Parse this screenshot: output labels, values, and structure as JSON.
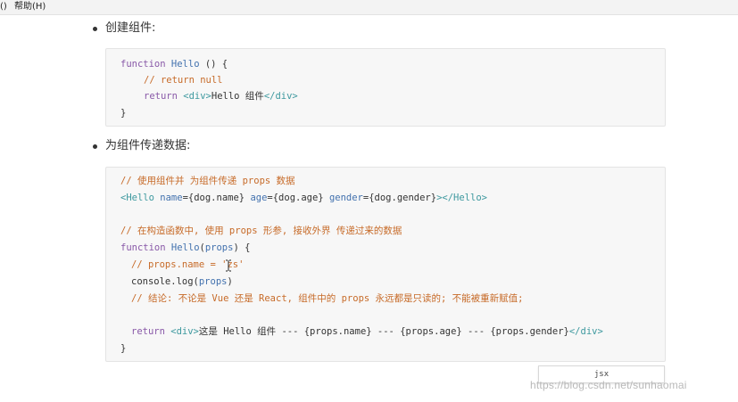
{
  "menubar": {
    "fragment": "()",
    "help": "帮助(H)"
  },
  "sections": [
    {
      "bullet_text": "创建组件:"
    },
    {
      "bullet_text": "为组件传递数据:"
    }
  ],
  "code1": {
    "l1": {
      "kw": "function",
      "fn": "Hello",
      "rest": " () {"
    },
    "l2": {
      "cm": "// return null"
    },
    "l3": {
      "kw": "return",
      "tag_open": "<div>",
      "text": "Hello 组件",
      "tag_close": "</div>"
    },
    "l4": {
      "text": "}"
    }
  },
  "code2": {
    "l1": {
      "cm": "// 使用组件并 为组件传递 props 数据"
    },
    "l2": {
      "tag_start": "<Hello",
      "a1": "name",
      "v1": "={dog.name}",
      "a2": "age",
      "v2": "={dog.age}",
      "a3": "gender",
      "v3": "={dog.gender}",
      "tag_end": "></Hello>"
    },
    "l3": {
      "cm": "// 在构造函数中, 使用 props 形参, 接收外界 传递过来的数据"
    },
    "l4": {
      "kw": "function",
      "fn": "Hello",
      "p1": "(",
      "param": "props",
      "p2": ") {"
    },
    "l5": {
      "cm": "// props.name = 'zs'"
    },
    "l6": {
      "t1": "console.log(",
      "param": "props",
      "t2": ")"
    },
    "l7": {
      "cm": "// 结论: 不论是 Vue 还是 React, 组件中的 props 永远都是只读的; 不能被重新赋值;"
    },
    "l8": {
      "kw": "return",
      "tag_open": "<div>",
      "text": "这是 Hello 组件 --- {props.name} --- {props.age} --- {props.gender}",
      "tag_close": "</div>"
    },
    "l9": {
      "text": "}"
    }
  },
  "lang_tag": "jsx",
  "watermark": "https://blog.csdn.net/sunhaomai"
}
